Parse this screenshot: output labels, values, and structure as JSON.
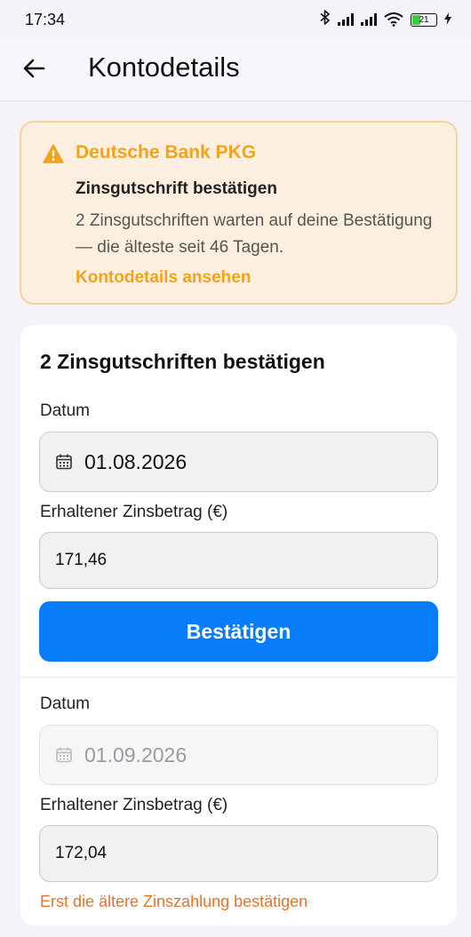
{
  "status_bar": {
    "time": "17:34",
    "battery": "21",
    "icons": [
      "bluetooth-icon",
      "signal-icon",
      "signal-icon",
      "wifi-icon",
      "battery-icon",
      "charging-icon"
    ]
  },
  "app_bar": {
    "back_icon": "arrow-left-icon",
    "title": "Kontodetails"
  },
  "alert": {
    "icon": "warning-icon",
    "bank": "Deutsche Bank PKG",
    "heading": "Zinsgutschrift bestätigen",
    "body": "2 Zinsgutschriften warten auf deine Bestätigung — die älteste seit 46 Tagen.",
    "link": "Kontodetails ansehen",
    "colors": {
      "accent": "#f2a318",
      "background": "#fcefe0",
      "border": "#efd4a3"
    }
  },
  "form": {
    "title": "2 Zinsgutschriften bestätigen",
    "entries": [
      {
        "date_label": "Datum",
        "date_value": "01.08.2026",
        "amount_label": "Erhaltener Zinsbetrag (€)",
        "amount_value": "171,46",
        "button_label": "Bestätigen"
      },
      {
        "date_label": "Datum",
        "date_value": "01.09.2026",
        "amount_label": "Erhaltener Zinsbetrag (€)",
        "amount_value": "172,04",
        "error": "Erst die ältere Zinszahlung bestätigen"
      }
    ],
    "colors": {
      "primary": "#077dfa",
      "error": "#e4742c"
    }
  }
}
